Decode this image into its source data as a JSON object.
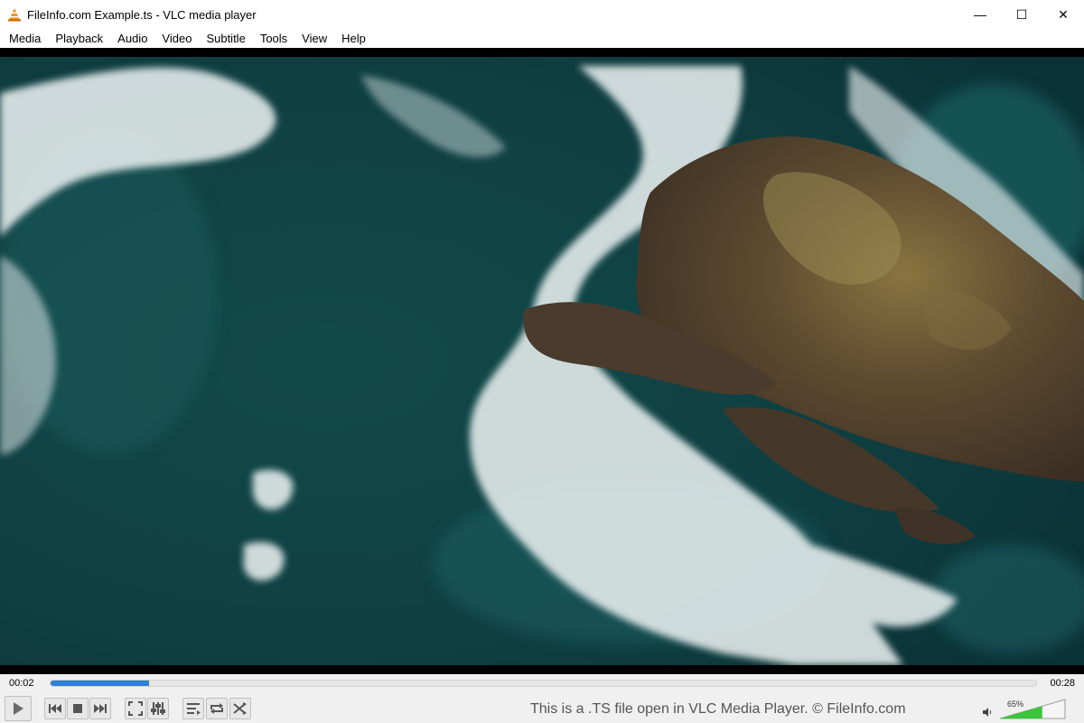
{
  "window": {
    "title": "FileInfo.com Example.ts - VLC media player",
    "minimize_glyph": "—",
    "maximize_glyph": "☐",
    "close_glyph": "✕"
  },
  "menu": {
    "items": [
      "Media",
      "Playback",
      "Audio",
      "Video",
      "Subtitle",
      "Tools",
      "View",
      "Help"
    ]
  },
  "player": {
    "time_elapsed": "00:02",
    "time_total": "00:28",
    "progress_fraction": 0.1,
    "volume_label": "65%",
    "volume_fraction": 0.65,
    "caption": "This is a .TS file open in VLC Media Player. © FileInfo.com"
  },
  "colors": {
    "accent": "#2f7fd6",
    "volume_green": "#3cc43c",
    "vlc_orange": "#f08c00"
  },
  "icons": {
    "play": "play-icon",
    "previous": "previous-icon",
    "stop": "stop-icon",
    "next": "next-icon",
    "fullscreen": "fullscreen-icon",
    "extended_settings": "equalizer-icon",
    "playlist": "playlist-icon",
    "loop": "loop-icon",
    "random": "shuffle-icon",
    "volume": "speaker-icon"
  }
}
